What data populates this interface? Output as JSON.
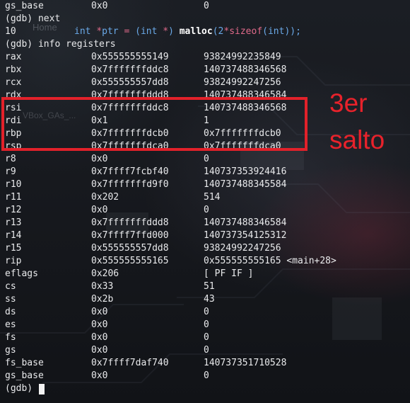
{
  "top_lines": [
    {
      "type": "reg",
      "name": "gs_base",
      "hex": "0x0",
      "nat": "0"
    },
    {
      "type": "plain",
      "text": "(gdb) next"
    }
  ],
  "source_line": {
    "num": "10",
    "tokens": [
      {
        "t": "int",
        "c": "kw"
      },
      {
        "t": " ",
        "c": "tx"
      },
      {
        "t": "*",
        "c": "op"
      },
      {
        "t": "ptr ",
        "c": "kw"
      },
      {
        "t": "=",
        "c": "op"
      },
      {
        "t": " (",
        "c": "kw"
      },
      {
        "t": "int",
        "c": "kw"
      },
      {
        "t": " ",
        "c": "tx"
      },
      {
        "t": "*",
        "c": "op"
      },
      {
        "t": ") ",
        "c": "kw"
      },
      {
        "t": "malloc",
        "c": "fn"
      },
      {
        "t": "(",
        "c": "kw"
      },
      {
        "t": "2",
        "c": "kw"
      },
      {
        "t": "*",
        "c": "op"
      },
      {
        "t": "sizeof",
        "c": "op"
      },
      {
        "t": "(",
        "c": "kw"
      },
      {
        "t": "int",
        "c": "kw"
      },
      {
        "t": "));",
        "c": "kw"
      }
    ]
  },
  "command_line": "(gdb) info registers",
  "registers": [
    {
      "name": "rax",
      "hex": "0x555555555149",
      "nat": "93824992235849"
    },
    {
      "name": "rbx",
      "hex": "0x7fffffffddc8",
      "nat": "140737488346568"
    },
    {
      "name": "rcx",
      "hex": "0x555555557dd8",
      "nat": "93824992247256"
    },
    {
      "name": "rdx",
      "hex": "0x7fffffffddd8",
      "nat": "140737488346584"
    },
    {
      "name": "rsi",
      "hex": "0x7fffffffddc8",
      "nat": "140737488346568"
    },
    {
      "name": "rdi",
      "hex": "0x1",
      "nat": "1"
    },
    {
      "name": "rbp",
      "hex": "0x7fffffffdcb0",
      "nat": "0x7fffffffdcb0"
    },
    {
      "name": "rsp",
      "hex": "0x7fffffffdca0",
      "nat": "0x7fffffffdca0"
    },
    {
      "name": "r8",
      "hex": "0x0",
      "nat": "0"
    },
    {
      "name": "r9",
      "hex": "0x7ffff7fcbf40",
      "nat": "140737353924416"
    },
    {
      "name": "r10",
      "hex": "0x7fffffffd9f0",
      "nat": "140737488345584"
    },
    {
      "name": "r11",
      "hex": "0x202",
      "nat": "514"
    },
    {
      "name": "r12",
      "hex": "0x0",
      "nat": "0"
    },
    {
      "name": "r13",
      "hex": "0x7fffffffddd8",
      "nat": "140737488346584"
    },
    {
      "name": "r14",
      "hex": "0x7ffff7ffd000",
      "nat": "140737354125312"
    },
    {
      "name": "r15",
      "hex": "0x555555557dd8",
      "nat": "93824992247256"
    },
    {
      "name": "rip",
      "hex": "0x555555555165",
      "nat": "0x555555555165 <main+28>"
    },
    {
      "name": "eflags",
      "hex": "0x206",
      "nat": "[ PF IF ]"
    },
    {
      "name": "cs",
      "hex": "0x33",
      "nat": "51"
    },
    {
      "name": "ss",
      "hex": "0x2b",
      "nat": "43"
    },
    {
      "name": "ds",
      "hex": "0x0",
      "nat": "0"
    },
    {
      "name": "es",
      "hex": "0x0",
      "nat": "0"
    },
    {
      "name": "fs",
      "hex": "0x0",
      "nat": "0"
    },
    {
      "name": "gs",
      "hex": "0x0",
      "nat": "0"
    },
    {
      "name": "fs_base",
      "hex": "0x7ffff7daf740",
      "nat": "140737351710528"
    },
    {
      "name": "gs_base",
      "hex": "0x0",
      "nat": "0"
    }
  ],
  "prompt": "(gdb)",
  "annotation": {
    "line1": "3er",
    "line2": "salto",
    "color": "#e2212a"
  },
  "background_labels": {
    "label1": "Home",
    "label2": "VBox_GAs_..."
  },
  "colors": {
    "keyword": "#6aa9e8",
    "operator": "#e06a8a",
    "text": "#e9eaec"
  }
}
